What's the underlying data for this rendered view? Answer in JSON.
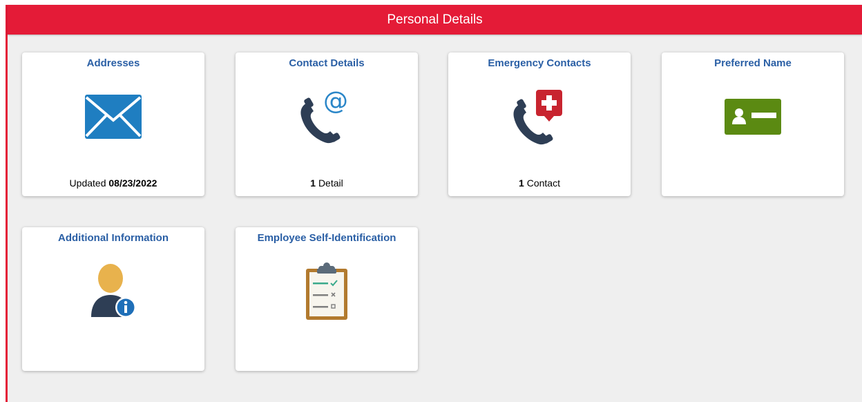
{
  "header": {
    "title": "Personal Details"
  },
  "colors": {
    "brand_red": "#e41b37",
    "tile_title_blue": "#2a5fa5",
    "background": "#efefef"
  },
  "tiles": [
    {
      "title": "Addresses",
      "icon": "envelope-icon",
      "footer_prefix": "Updated",
      "footer_value": "08/23/2022"
    },
    {
      "title": "Contact Details",
      "icon": "phone-at-icon",
      "footer_count": "1",
      "footer_suffix": "Detail"
    },
    {
      "title": "Emergency Contacts",
      "icon": "phone-medical-icon",
      "footer_count": "1",
      "footer_suffix": "Contact"
    },
    {
      "title": "Preferred Name",
      "icon": "id-card-icon"
    },
    {
      "title": "Additional Information",
      "icon": "person-info-icon"
    },
    {
      "title": "Employee Self-Identification",
      "icon": "clipboard-checklist-icon"
    }
  ]
}
